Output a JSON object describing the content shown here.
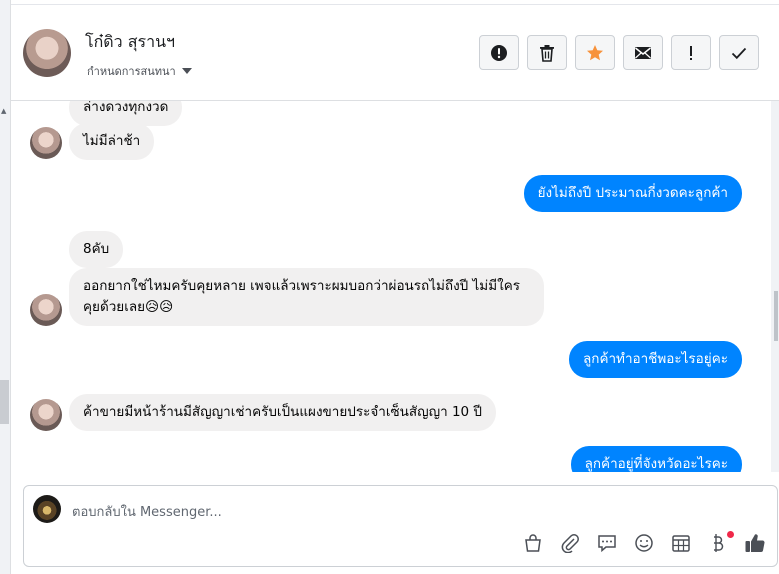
{
  "header": {
    "contact_name": "โก๋ดิว สุรานฯ",
    "label_dropdown": "กำหนดการสนทนา",
    "actions": [
      "mark-spam",
      "delete",
      "star",
      "mark-unread",
      "follow-up",
      "mark-done"
    ]
  },
  "messages": [
    {
      "dir": "in",
      "text": "ล่างดวงทุกงวด"
    },
    {
      "dir": "in",
      "text": "ไม่มีล่าช้า"
    },
    {
      "dir": "out",
      "text": "ยังไม่ถึงปี ประมาณกี่งวดคะลูกค้า"
    },
    {
      "dir": "in",
      "text": "8คับ"
    },
    {
      "dir": "in",
      "text": "ออกยากใช่ไหมครับคุยหลาย เพจแล้วเพราะผมบอกว่าผ่อนรถไม่ถึงปี ไม่มีใครคุยด้วยเลย😥😥"
    },
    {
      "dir": "out",
      "text": "ลูกค้าทำอาชีพอะไรอยู่คะ"
    },
    {
      "dir": "in",
      "text": "ค้าขายมีหน้าร้านมีสัญญาเช่าครับเป็นแผงขายประจำเซ็นสัญญา 10 ปี"
    },
    {
      "dir": "out",
      "text": "ลูกค้าอยู่ที่จังหวัดอะไรคะ"
    }
  ],
  "composer": {
    "placeholder": "ตอบกลับใน Messenger...",
    "tools": [
      "bag-icon",
      "attachment-icon",
      "saved-replies-icon",
      "emoji-icon",
      "calendar-icon",
      "baht-icon",
      "thumbs-up-icon"
    ]
  },
  "colors": {
    "outgoing_bubble": "#0084ff",
    "incoming_bubble": "#f1f0f0",
    "star": "#f7923b",
    "notification_dot": "#f02849"
  }
}
